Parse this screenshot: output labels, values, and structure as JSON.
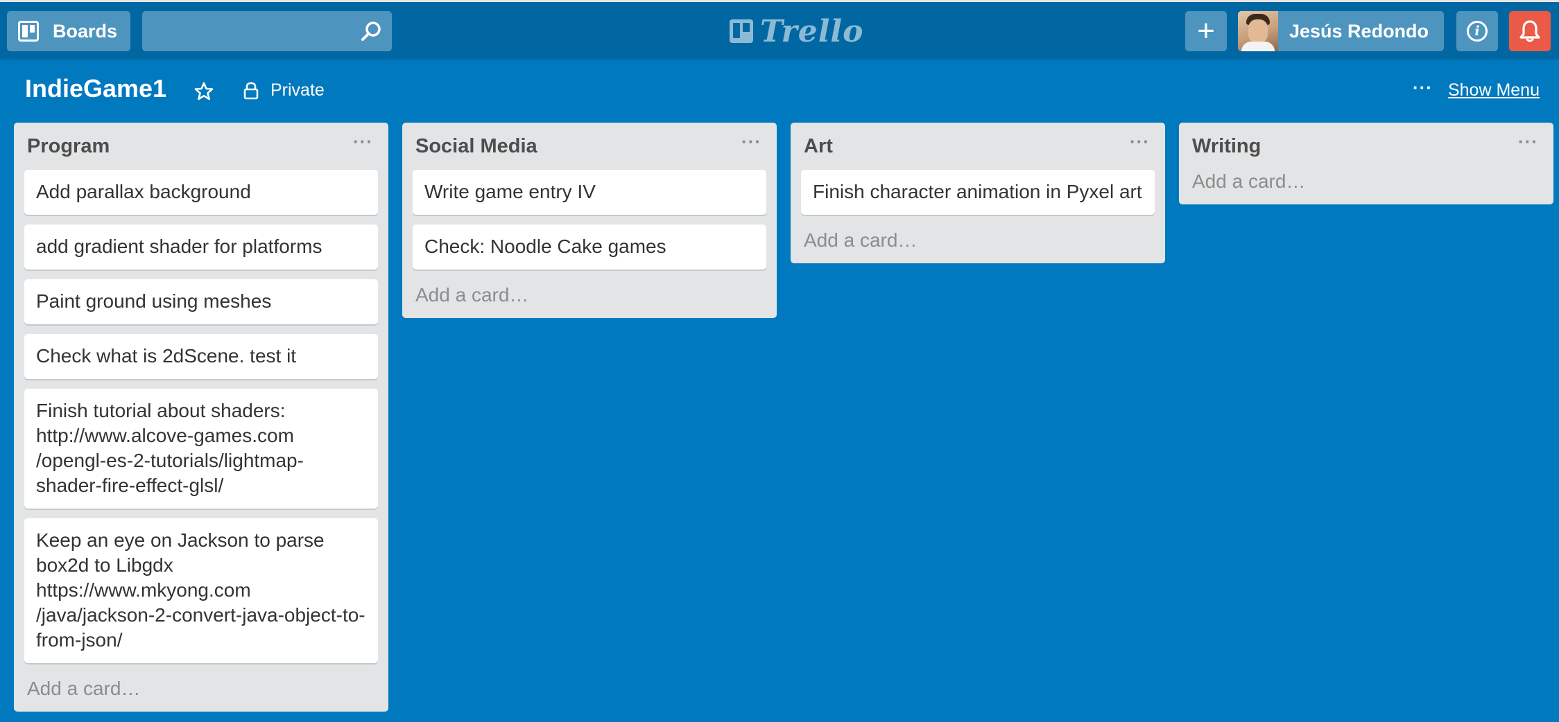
{
  "header": {
    "boards_label": "Boards",
    "search_placeholder": "",
    "logo_text": "Trello",
    "member_name": "Jesús Redondo",
    "info_label": "i",
    "add_label": "+"
  },
  "board": {
    "title": "IndieGame1",
    "privacy": "Private",
    "menu_dots": "···",
    "show_menu": "Show Menu"
  },
  "lists": [
    {
      "title": "Program",
      "menu": "···",
      "cards": [
        "Add parallax background",
        "add gradient shader for platforms",
        "Paint ground using meshes",
        "Check what is 2dScene. test it",
        "Finish tutorial about shaders: http://www.alcove-games.com /opengl-es-2-tutorials/lightmap-shader-fire-effect-glsl/",
        "Keep an eye on Jackson to parse box2d to Libgdx https://www.mkyong.com /java/jackson-2-convert-java-object-to-from-json/"
      ],
      "add_card": "Add a card…"
    },
    {
      "title": "Social Media",
      "menu": "···",
      "cards": [
        "Write game entry IV",
        "Check: Noodle Cake games"
      ],
      "add_card": "Add a card…"
    },
    {
      "title": "Art",
      "menu": "···",
      "cards": [
        "Finish character animation in Pyxel art"
      ],
      "add_card": "Add a card…"
    },
    {
      "title": "Writing",
      "menu": "···",
      "cards": [],
      "add_card": "Add a card…"
    }
  ],
  "colors": {
    "board_bg": "#0079bf",
    "header_bg": "#0067a3",
    "list_bg": "#e2e4e6",
    "notification": "#eb5a46"
  }
}
